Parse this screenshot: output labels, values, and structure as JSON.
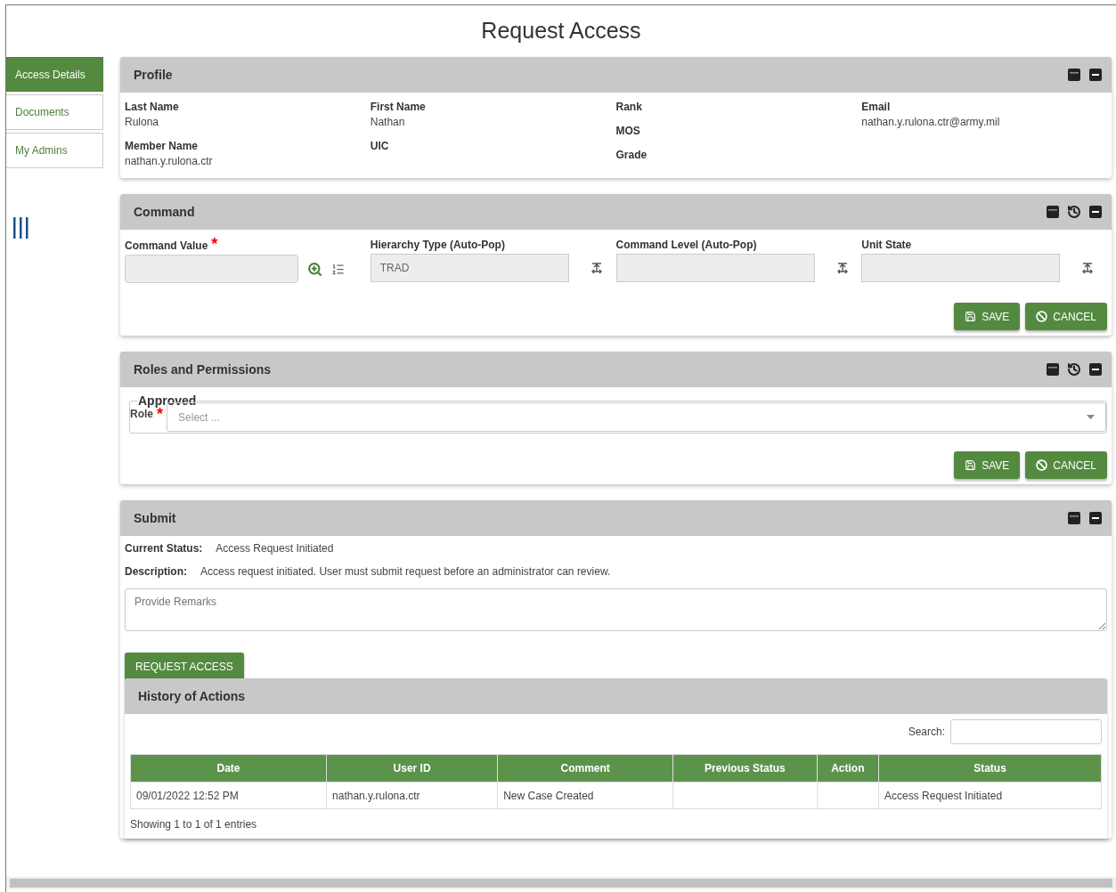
{
  "title": "Request Access",
  "sidebar": {
    "tabs": [
      {
        "label": "Access Details",
        "selected": true
      },
      {
        "label": "Documents",
        "selected": false
      },
      {
        "label": "My Admins",
        "selected": false
      }
    ]
  },
  "profile": {
    "title": "Profile",
    "history": false,
    "columns": [
      [
        {
          "label": "Last Name",
          "value": "Rulona"
        },
        {
          "label": "Member Name",
          "value": "nathan.y.rulona.ctr"
        }
      ],
      [
        {
          "label": "First Name",
          "value": "Nathan"
        },
        {
          "label": "UIC"
        }
      ],
      [
        {
          "label": "Rank"
        },
        {
          "label": "MOS"
        },
        {
          "label": "Grade"
        }
      ],
      [
        {
          "label": "Email",
          "value": "nathan.y.rulona.ctr@army.mil"
        }
      ]
    ]
  },
  "command": {
    "title": "Command",
    "history": true,
    "fields": [
      {
        "kind": "lookup",
        "label": "Command Value",
        "required_mark": "*"
      },
      {
        "kind": "auto",
        "label": "Hierarchy Type (Auto-Pop)",
        "value": "TRAD"
      },
      {
        "kind": "auto",
        "label": "Command Level (Auto-Pop)"
      },
      {
        "kind": "auto",
        "label": "Unit State"
      }
    ],
    "buttons": [
      {
        "kind": "save",
        "label": "SAVE"
      },
      {
        "kind": "cancel",
        "label": "CANCEL"
      }
    ]
  },
  "roles": {
    "title": "Roles and Permissions",
    "history": true,
    "legend": "Approved",
    "role_label": "Role",
    "required_mark": "*",
    "placeholder": "Select ...",
    "buttons": [
      {
        "kind": "save",
        "label": "SAVE"
      },
      {
        "kind": "cancel",
        "label": "CANCEL"
      }
    ]
  },
  "submit": {
    "title": "Submit",
    "history": false,
    "info": [
      {
        "label": "Current Status:",
        "value": "Access Request Initiated"
      },
      {
        "label": "Description:",
        "value": "Access request initiated. User must submit request before an administrator can review."
      }
    ],
    "remarks_placeholder": "Provide Remarks",
    "button": "REQUEST ACCESS",
    "history_table": {
      "title": "History of Actions",
      "search_label": "Search:",
      "columns": [
        "Date",
        "User ID",
        "Comment",
        "Previous Status",
        "Action",
        "Status"
      ],
      "rows": [
        [
          "09/01/2022 12:52 PM",
          "nathan.y.rulona.ctr",
          "New Case Created",
          "",
          "",
          "Access Request Initiated"
        ]
      ],
      "footer": "Showing 1 to 1 of 1 entries"
    }
  }
}
